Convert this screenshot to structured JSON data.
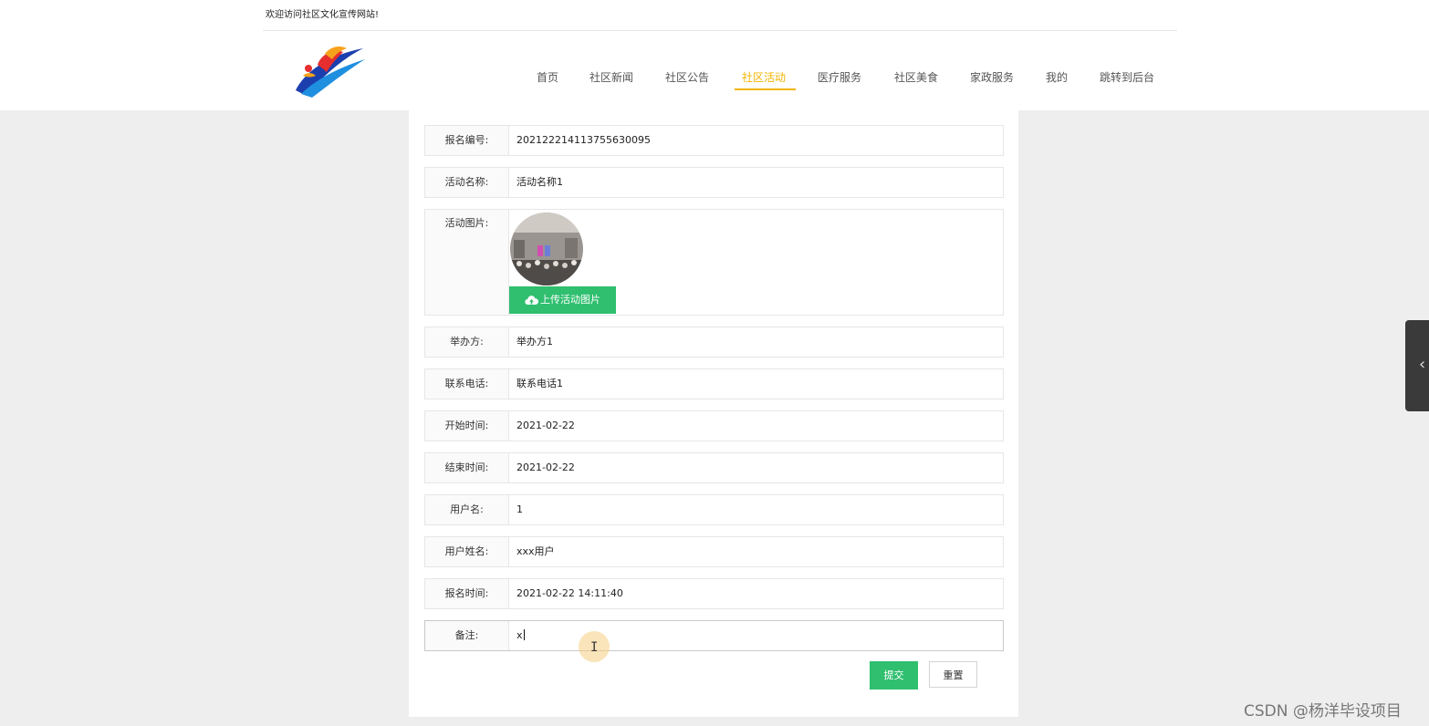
{
  "header": {
    "welcome": "欢迎访问社区文化宣传网站!",
    "logo_icon": "site-logo-icon",
    "nav": [
      {
        "label": "首页",
        "active": false
      },
      {
        "label": "社区新闻",
        "active": false
      },
      {
        "label": "社区公告",
        "active": false
      },
      {
        "label": "社区活动",
        "active": true
      },
      {
        "label": "医疗服务",
        "active": false
      },
      {
        "label": "社区美食",
        "active": false
      },
      {
        "label": "家政服务",
        "active": false
      },
      {
        "label": "我的",
        "active": false
      },
      {
        "label": "跳转到后台",
        "active": false
      }
    ]
  },
  "form": {
    "fields": [
      {
        "label": "报名编号:",
        "value": "202122214113755630095"
      },
      {
        "label": "活动名称:",
        "value": "活动名称1"
      },
      {
        "label": "活动图片:",
        "upload_label": "上传活动图片"
      },
      {
        "label": "举办方:",
        "value": "举办方1"
      },
      {
        "label": "联系电话:",
        "value": "联系电话1"
      },
      {
        "label": "开始时间:",
        "value": "2021-02-22"
      },
      {
        "label": "结束时间:",
        "value": "2021-02-22"
      },
      {
        "label": "用户名:",
        "value": "1"
      },
      {
        "label": "用户姓名:",
        "value": "xxx用户"
      },
      {
        "label": "报名时间:",
        "value": "2021-02-22 14:11:40"
      },
      {
        "label": "备注:",
        "value": "x"
      }
    ],
    "submit_label": "提交",
    "reset_label": "重置"
  },
  "cursor": {
    "glyph": "I"
  },
  "side_tab": {
    "glyph": "‹"
  },
  "watermark": "CSDN @杨洋毕设项目",
  "colors": {
    "accent": "#f2b400",
    "button_green": "#2fbf6f",
    "page_bg": "#eeeeef"
  }
}
